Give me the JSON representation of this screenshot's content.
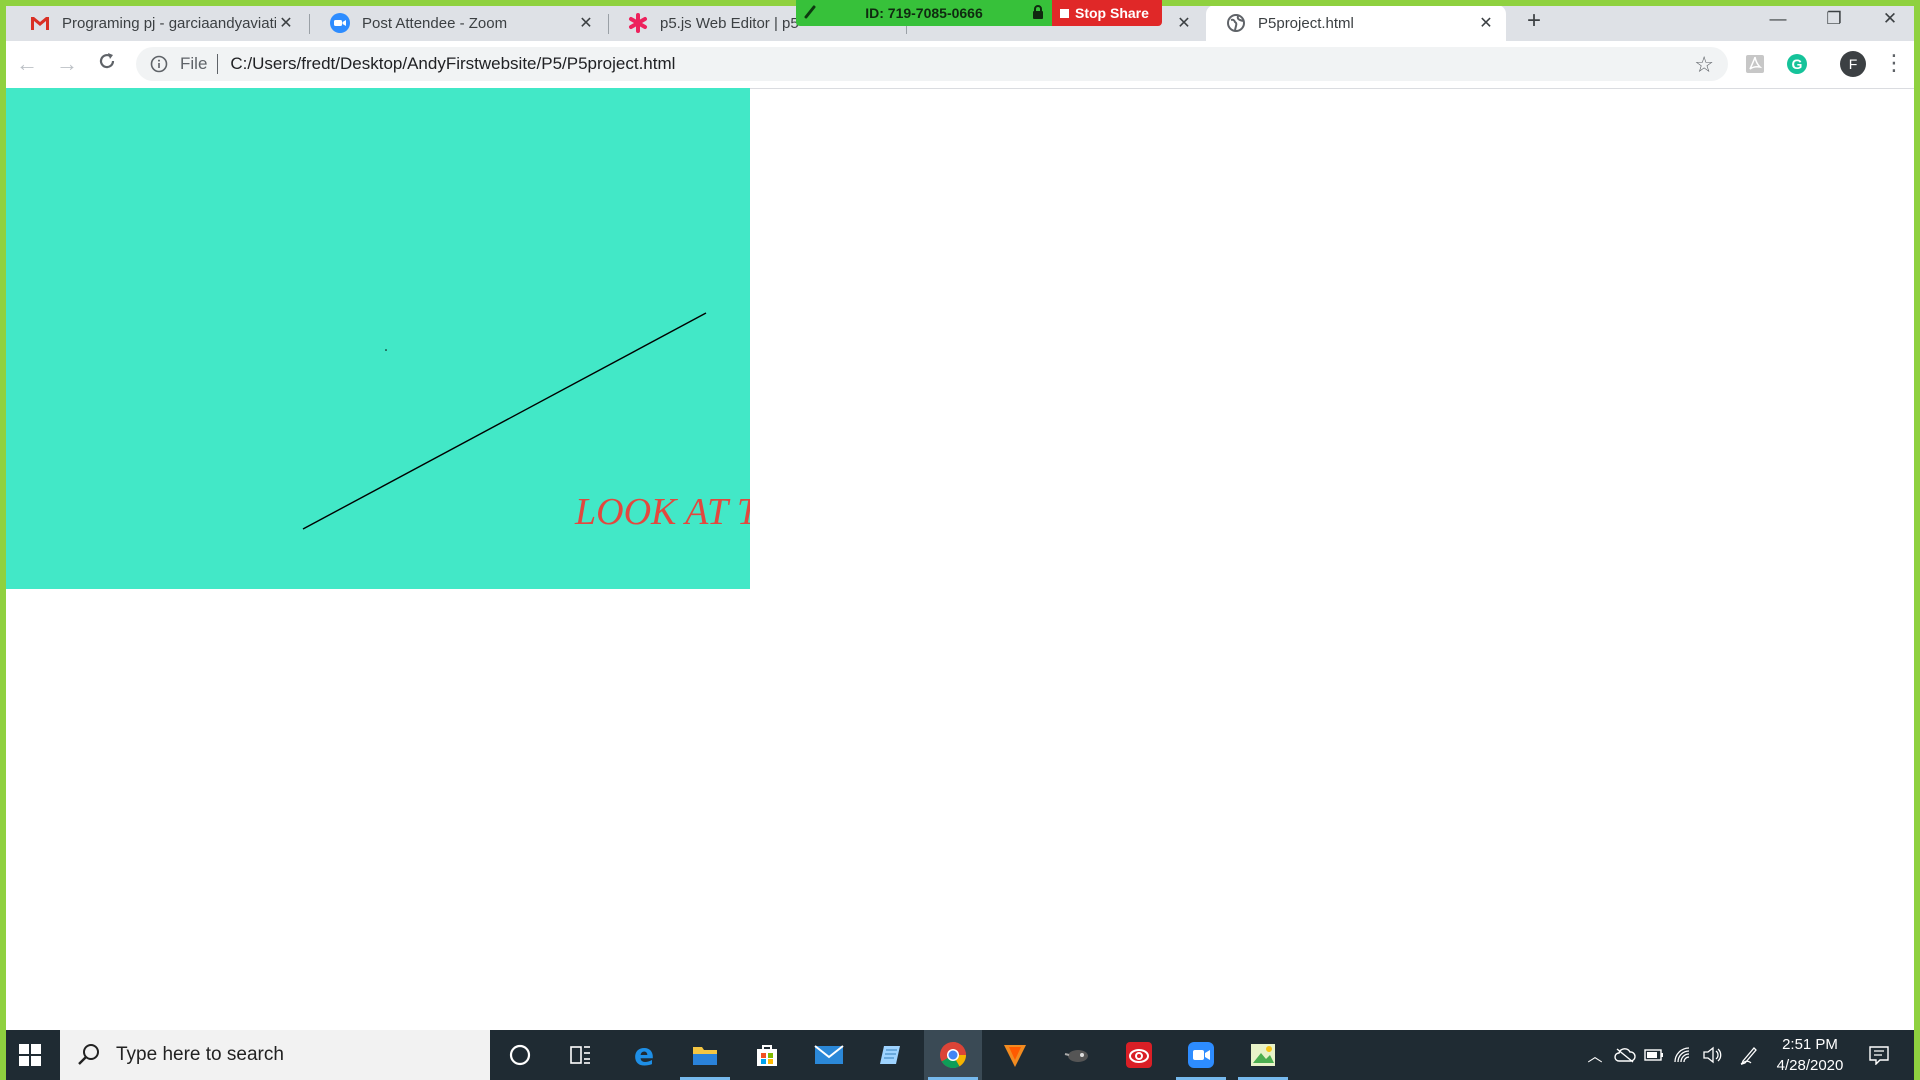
{
  "browser": {
    "tabs": [
      {
        "title": "Programing pj - garciaandyaviati",
        "icon": "gmail-icon"
      },
      {
        "title": "Post Attendee - Zoom",
        "icon": "zoom-icon"
      },
      {
        "title": "p5.js Web Editor | p5",
        "icon": "p5-asterisk-icon"
      },
      {
        "title": "P5project.html",
        "icon": "globe-icon",
        "active": true
      }
    ],
    "address": {
      "scheme": "File",
      "url": "C:/Users/fredt/Desktop/AndyFirstwebsite/P5/P5project.html"
    },
    "profile_initial": "F"
  },
  "zoom_share": {
    "meeting_id": "ID: 719-7085-0666",
    "stop_label": "Stop Share",
    "colors": {
      "bar": "#37c13a",
      "stop": "#e02828",
      "frame": "#8fd13f"
    }
  },
  "page": {
    "canvas_background": "#42e8c7",
    "canvas_text": "LOOK AT T",
    "text_color": "#e2483f",
    "line_color": "#000000"
  },
  "taskbar": {
    "search_placeholder": "Type here to search",
    "time": "2:51 PM",
    "date": "4/28/2020",
    "pinned": [
      "cortana-icon",
      "task-view-icon",
      "edge-icon",
      "file-explorer-icon",
      "store-icon",
      "mail-icon",
      "notepad-icon",
      "chrome-icon",
      "vlc-icon",
      "app-icon",
      "creative-cloud-icon",
      "zoom-icon",
      "image-app-icon"
    ]
  }
}
